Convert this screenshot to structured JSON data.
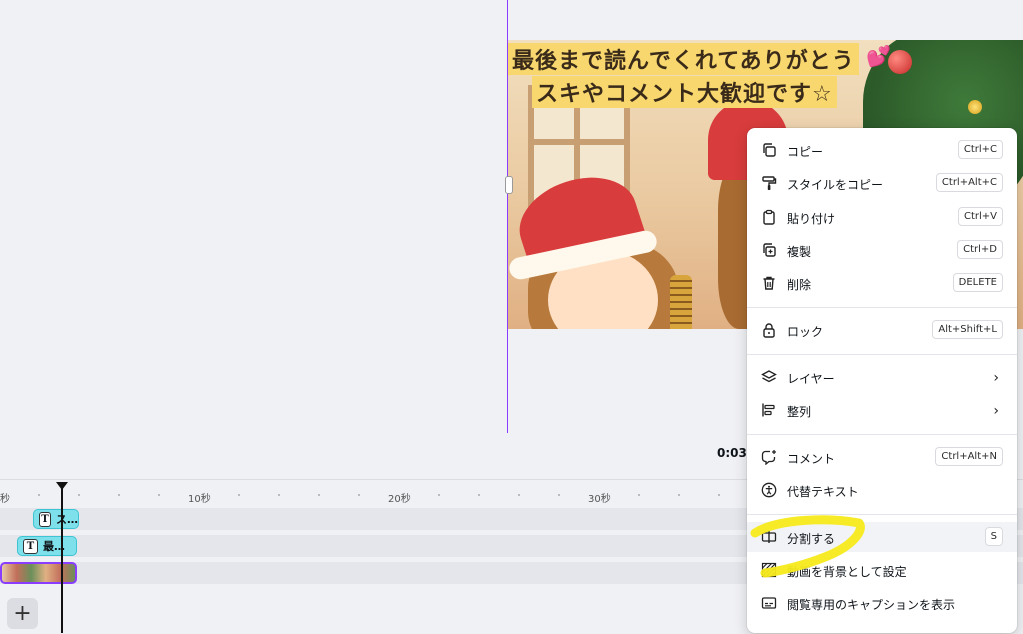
{
  "canvas": {
    "caption_line1": "最後まで読んでくれてありがとう",
    "caption_line2": "スキやコメント大歓迎です☆",
    "heart": "💕",
    "time_label": "0:03"
  },
  "timeline": {
    "ruler": [
      "秒",
      "10秒",
      "20秒",
      "30秒"
    ],
    "text_clip1_label": "ス…",
    "text_clip2_label": "最…",
    "add_symbol": "+"
  },
  "menu": {
    "items": [
      {
        "label": "コピー",
        "shortcut": "Ctrl+C",
        "icon": "copy-icon"
      },
      {
        "label": "スタイルをコピー",
        "shortcut": "Ctrl+Alt+C",
        "icon": "paint-roller-icon"
      },
      {
        "label": "貼り付け",
        "shortcut": "Ctrl+V",
        "icon": "clipboard-icon"
      },
      {
        "label": "複製",
        "shortcut": "Ctrl+D",
        "icon": "duplicate-icon"
      },
      {
        "label": "削除",
        "shortcut": "DELETE",
        "icon": "trash-icon"
      },
      {
        "label": "ロック",
        "shortcut": "Alt+Shift+L",
        "icon": "lock-icon"
      },
      {
        "label": "レイヤー",
        "shortcut": "",
        "icon": "layers-icon"
      },
      {
        "label": "整列",
        "shortcut": "",
        "icon": "align-icon"
      },
      {
        "label": "コメント",
        "shortcut": "Ctrl+Alt+N",
        "icon": "comment-add-icon"
      },
      {
        "label": "代替テキスト",
        "shortcut": "",
        "icon": "accessibility-icon"
      },
      {
        "label": "分割する",
        "shortcut": "S",
        "icon": "split-icon"
      },
      {
        "label": "動画を背景として設定",
        "shortcut": "",
        "icon": "background-icon"
      },
      {
        "label": "閲覧専用のキャプションを表示",
        "shortcut": "",
        "icon": "captions-icon"
      }
    ]
  },
  "colors": {
    "accent": "#8b3dff",
    "clip_text": "#7ee0ea",
    "highlight_mark": "#f5ea1a"
  }
}
